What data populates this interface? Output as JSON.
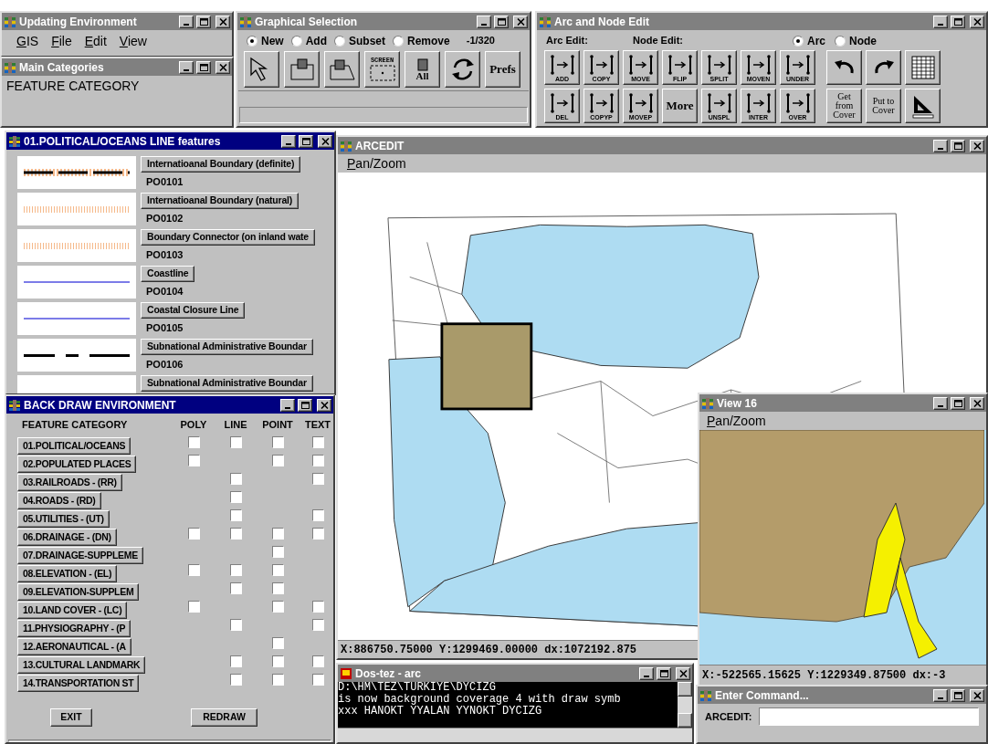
{
  "updating_environment": {
    "title": "Updating Environment",
    "active": false,
    "menu": [
      "GIS",
      "File",
      "Edit",
      "View"
    ]
  },
  "main_categories": {
    "title": "Main Categories",
    "active": false,
    "label": "FEATURE CATEGORY"
  },
  "graphical_selection": {
    "title": "Graphical Selection",
    "active": false,
    "modes": [
      {
        "label": "New",
        "selected": true
      },
      {
        "label": "Add",
        "selected": false
      },
      {
        "label": "Subset",
        "selected": false
      },
      {
        "label": "Remove",
        "selected": false
      }
    ],
    "count": "-1/320",
    "tools": [
      {
        "kind": "pointer"
      },
      {
        "kind": "box"
      },
      {
        "kind": "polygon"
      },
      {
        "kind": "screen",
        "label": "SCREEN"
      },
      {
        "kind": "all",
        "label": "All"
      },
      {
        "kind": "refresh"
      },
      {
        "kind": "text",
        "label": "Prefs"
      }
    ]
  },
  "arc_node_edit": {
    "title": "Arc and Node Edit",
    "active": false,
    "arc_label": "Arc Edit:",
    "node_label": "Node Edit:",
    "modes": [
      {
        "label": "Arc",
        "selected": true
      },
      {
        "label": "Node",
        "selected": false
      }
    ],
    "edit_buttons": [
      {
        "kind": "icon",
        "label": "ADD"
      },
      {
        "kind": "icon",
        "label": "COPY"
      },
      {
        "kind": "icon",
        "label": "MOVE"
      },
      {
        "kind": "icon",
        "label": "FLIP"
      },
      {
        "kind": "icon",
        "label": "SPLIT"
      },
      {
        "kind": "icon",
        "label": "MOVEN"
      },
      {
        "kind": "icon",
        "label": "UNDER"
      },
      {
        "kind": "icon",
        "label": "DEL"
      },
      {
        "kind": "icon",
        "label": "COPYP"
      },
      {
        "kind": "icon",
        "label": "MOVEP"
      },
      {
        "kind": "text",
        "label": "More"
      },
      {
        "kind": "icon",
        "label": "UNSPL"
      },
      {
        "kind": "icon",
        "label": "INTER"
      },
      {
        "kind": "icon",
        "label": "OVER"
      }
    ],
    "tool_buttons": [
      {
        "kind": "undo"
      },
      {
        "kind": "redo"
      },
      {
        "kind": "table"
      },
      {
        "kind": "text",
        "label": "Get from Cover"
      },
      {
        "kind": "text",
        "label": "Put to Cover"
      },
      {
        "kind": "triangle"
      }
    ]
  },
  "features": {
    "title": "01.POLITICAL/OCEANS LINE features",
    "active": true,
    "items": [
      {
        "kind": "dash_halo",
        "label": "Internatioanal Boundary (definite)",
        "code": "PO0101"
      },
      {
        "kind": "hatched",
        "label": "Internatioanal Boundary (natural)",
        "code": "PO0102"
      },
      {
        "kind": "hatched",
        "label": "Boundary Connector (on inland wate",
        "code": "PO0103"
      },
      {
        "kind": "blue",
        "label": "Coastline",
        "code": "PO0104"
      },
      {
        "kind": "blue",
        "label": "Coastal Closure Line",
        "code": "PO0105"
      },
      {
        "kind": "dash",
        "label": "Subnational Administrative Boundar",
        "code": "PO0106"
      },
      {
        "kind": "blank",
        "label": "Subnational Administrative Boundar"
      }
    ]
  },
  "back_draw": {
    "title": "BACK DRAW ENVIRONMENT",
    "active": true,
    "columns": [
      "FEATURE CATEGORY",
      "POLY",
      "LINE",
      "POINT",
      "TEXT"
    ],
    "rows": [
      {
        "label": "01.POLITICAL/OCEANS",
        "boxes": {
          "poly": false,
          "line": false,
          "point": false,
          "text": false
        }
      },
      {
        "label": "02.POPULATED PLACES",
        "boxes": {
          "poly": false,
          "point": false,
          "text": false
        }
      },
      {
        "label": "03.RAILROADS - (RR)",
        "boxes": {
          "line": false,
          "text": false
        }
      },
      {
        "label": "04.ROADS - (RD)",
        "boxes": {
          "line": false
        }
      },
      {
        "label": "05.UTILITIES - (UT)",
        "boxes": {
          "line": false,
          "text": false
        }
      },
      {
        "label": "06.DRAINAGE - (DN)",
        "boxes": {
          "poly": false,
          "line": false,
          "point": false,
          "text": false
        }
      },
      {
        "label": "07.DRAINAGE-SUPPLEME",
        "boxes": {
          "point": false
        }
      },
      {
        "label": "08.ELEVATION - (EL)",
        "boxes": {
          "poly": false,
          "line": false,
          "point": false
        }
      },
      {
        "label": "09.ELEVATION-SUPPLEM",
        "boxes": {
          "line": false,
          "point": false
        }
      },
      {
        "label": "10.LAND COVER - (LC)",
        "boxes": {
          "poly": false,
          "point": false,
          "text": false
        }
      },
      {
        "label": "11.PHYSIOGRAPHY - (P",
        "boxes": {
          "line": false,
          "text": false
        }
      },
      {
        "label": "12.AERONAUTICAL - (A",
        "boxes": {
          "point": false
        }
      },
      {
        "label": "13.CULTURAL LANDMARK",
        "boxes": {
          "line": false,
          "point": false,
          "text": false
        }
      },
      {
        "label": "14.TRANSPORTATION ST",
        "boxes": {
          "line": false,
          "point": false,
          "text": false
        }
      }
    ],
    "buttons": [
      "EXIT",
      "REDRAW"
    ]
  },
  "arcedit": {
    "title": "ARCEDIT",
    "active": false,
    "menu": "Pan/Zoom",
    "coordinates": "X:886750.75000 Y:1299469.00000 dx:1072192.875"
  },
  "view_16": {
    "title": "View 16",
    "active": false,
    "menu": "Pan/Zoom",
    "coordinates": "X:-522565.15625 Y:1229349.87500 dx:-3"
  },
  "dos": {
    "title": "Dos-tez - arc",
    "active": false,
    "lines": [
      "D:\\HM\\TEZ\\TURKIYE\\DYCIZG",
      "is now background coverage 4 with draw symb",
      "xxx HANOKT YYALAN YYNOKT DYCIZG"
    ]
  },
  "enter_command": {
    "title": "Enter Command...",
    "active": false,
    "label": "ARCEDIT:"
  }
}
